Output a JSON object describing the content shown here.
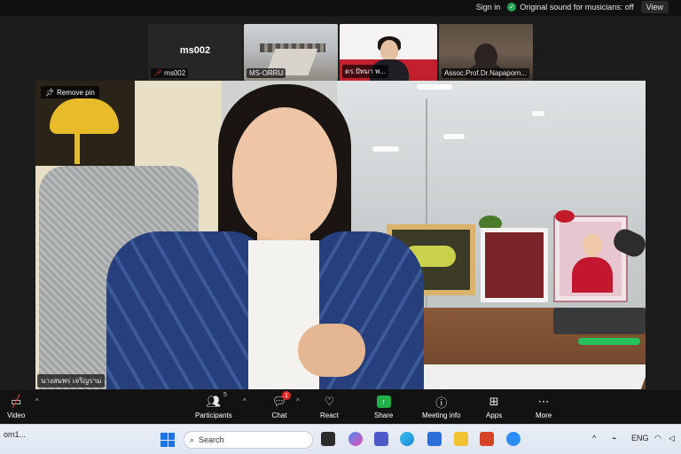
{
  "topbar": {
    "sign_in": "Sign in",
    "sound_label": "Original sound for musicians: off",
    "view_label": "View"
  },
  "thumbnails": [
    {
      "name": "ms002",
      "center_label": "ms002"
    },
    {
      "name": "MS-ORRU"
    },
    {
      "name": "ดร.ปัทมา พ..."
    },
    {
      "name": "Assoc.Prof.Dr.Napaporn..."
    }
  ],
  "stage": {
    "remove_pin": "Remove pin",
    "speaker_name": "นางสมพร เจริญราม"
  },
  "controls": {
    "video": "Video",
    "participants": "Participants",
    "participants_count": "5",
    "chat": "Chat",
    "chat_badge": "1",
    "react": "React",
    "share": "Share",
    "meeting_info": "Meeting info",
    "apps": "Apps",
    "more": "More"
  },
  "taskbar": {
    "left_text": "om1...",
    "search_placeholder": "Search",
    "lang": "ENG"
  },
  "colors": {
    "share_green": "#20b04a",
    "badge_red": "#e02828",
    "bar_bg": "#121212"
  }
}
